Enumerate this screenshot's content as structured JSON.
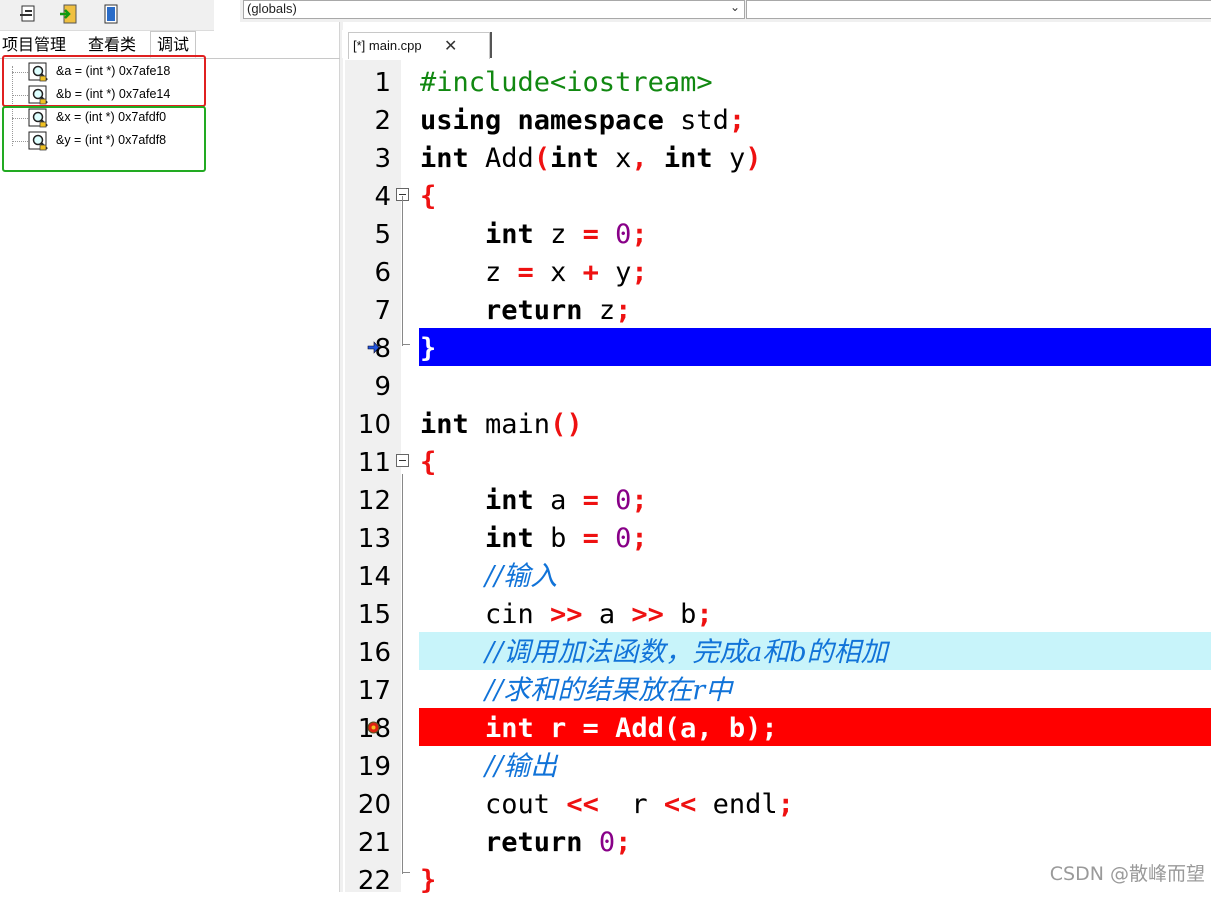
{
  "top_bar": {
    "scope": "(globals)"
  },
  "panel_tabs": [
    "项目管理",
    "查看类",
    "调试"
  ],
  "watches": [
    {
      "text": "&a = (int *) 0x7afe18"
    },
    {
      "text": "&b = (int *) 0x7afe14"
    },
    {
      "text": "&x = (int *) 0x7afdf0"
    },
    {
      "text": "&y = (int *) 0x7afdf8"
    }
  ],
  "editor": {
    "tab_label": "[*] main.cpp",
    "tab_close": "✕",
    "current_line": 8,
    "breakpoint_line": 18,
    "selected_line": 16,
    "colors": {
      "current": "#0000ff",
      "breakpoint": "#ff0000",
      "selected": "#c8f4fa"
    },
    "lines": [
      {
        "n": "1",
        "tokens": [
          {
            "t": "#include<iostream>",
            "c": "pp"
          }
        ]
      },
      {
        "n": "2",
        "tokens": [
          {
            "t": "using namespace",
            "c": "kw"
          },
          {
            "t": " std",
            "c": "id"
          },
          {
            "t": ";",
            "c": "sym"
          }
        ]
      },
      {
        "n": "3",
        "tokens": [
          {
            "t": "int",
            "c": "kw"
          },
          {
            "t": " Add",
            "c": "id"
          },
          {
            "t": "(",
            "c": "sym"
          },
          {
            "t": "int",
            "c": "kw"
          },
          {
            "t": " x",
            "c": "id"
          },
          {
            "t": ",",
            "c": "sym"
          },
          {
            "t": " ",
            "c": "id"
          },
          {
            "t": "int",
            "c": "kw"
          },
          {
            "t": " y",
            "c": "id"
          },
          {
            "t": ")",
            "c": "sym"
          }
        ]
      },
      {
        "n": "4",
        "fold": true,
        "tokens": [
          {
            "t": "{",
            "c": "sym"
          }
        ]
      },
      {
        "n": "5",
        "tokens": [
          {
            "t": "    ",
            "c": "id"
          },
          {
            "t": "int",
            "c": "kw"
          },
          {
            "t": " z ",
            "c": "id"
          },
          {
            "t": "=",
            "c": "sym"
          },
          {
            "t": " ",
            "c": "id"
          },
          {
            "t": "0",
            "c": "num"
          },
          {
            "t": ";",
            "c": "sym"
          }
        ]
      },
      {
        "n": "6",
        "tokens": [
          {
            "t": "    z ",
            "c": "id"
          },
          {
            "t": "=",
            "c": "sym"
          },
          {
            "t": " x ",
            "c": "id"
          },
          {
            "t": "+",
            "c": "sym"
          },
          {
            "t": " y",
            "c": "id"
          },
          {
            "t": ";",
            "c": "sym"
          }
        ]
      },
      {
        "n": "7",
        "tokens": [
          {
            "t": "    ",
            "c": "id"
          },
          {
            "t": "return",
            "c": "kw"
          },
          {
            "t": " z",
            "c": "id"
          },
          {
            "t": ";",
            "c": "sym"
          }
        ]
      },
      {
        "n": "8",
        "tokens": [
          {
            "t": "}",
            "c": "sym"
          }
        ]
      },
      {
        "n": "9",
        "tokens": []
      },
      {
        "n": "10",
        "tokens": [
          {
            "t": "int",
            "c": "kw"
          },
          {
            "t": " main",
            "c": "id"
          },
          {
            "t": "()",
            "c": "sym"
          }
        ]
      },
      {
        "n": "11",
        "fold": true,
        "tokens": [
          {
            "t": "{",
            "c": "sym"
          }
        ]
      },
      {
        "n": "12",
        "tokens": [
          {
            "t": "    ",
            "c": "id"
          },
          {
            "t": "int",
            "c": "kw"
          },
          {
            "t": " a ",
            "c": "id"
          },
          {
            "t": "=",
            "c": "sym"
          },
          {
            "t": " ",
            "c": "id"
          },
          {
            "t": "0",
            "c": "num"
          },
          {
            "t": ";",
            "c": "sym"
          }
        ]
      },
      {
        "n": "13",
        "tokens": [
          {
            "t": "    ",
            "c": "id"
          },
          {
            "t": "int",
            "c": "kw"
          },
          {
            "t": " b ",
            "c": "id"
          },
          {
            "t": "=",
            "c": "sym"
          },
          {
            "t": " ",
            "c": "id"
          },
          {
            "t": "0",
            "c": "num"
          },
          {
            "t": ";",
            "c": "sym"
          }
        ]
      },
      {
        "n": "14",
        "tokens": [
          {
            "t": "    ",
            "c": "id"
          },
          {
            "t": "//输入",
            "c": "cmt"
          }
        ]
      },
      {
        "n": "15",
        "tokens": [
          {
            "t": "    cin ",
            "c": "id"
          },
          {
            "t": ">>",
            "c": "sym"
          },
          {
            "t": " a ",
            "c": "id"
          },
          {
            "t": ">>",
            "c": "sym"
          },
          {
            "t": " b",
            "c": "id"
          },
          {
            "t": ";",
            "c": "sym"
          }
        ]
      },
      {
        "n": "16",
        "tokens": [
          {
            "t": "    ",
            "c": "id"
          },
          {
            "t": "//调用加法函数，完成a和b的相加",
            "c": "cmt"
          }
        ]
      },
      {
        "n": "17",
        "tokens": [
          {
            "t": "    ",
            "c": "id"
          },
          {
            "t": "//求和的结果放在r中",
            "c": "cmt"
          }
        ]
      },
      {
        "n": "18",
        "tokens": [
          {
            "t": "    int r = Add(a, b);",
            "c": "kw"
          }
        ]
      },
      {
        "n": "19",
        "tokens": [
          {
            "t": "    ",
            "c": "id"
          },
          {
            "t": "//输出",
            "c": "cmt"
          }
        ]
      },
      {
        "n": "20",
        "tokens": [
          {
            "t": "    cout ",
            "c": "id"
          },
          {
            "t": "<<",
            "c": "sym"
          },
          {
            "t": "  r ",
            "c": "id"
          },
          {
            "t": "<<",
            "c": "sym"
          },
          {
            "t": " endl",
            "c": "id"
          },
          {
            "t": ";",
            "c": "sym"
          }
        ]
      },
      {
        "n": "21",
        "tokens": [
          {
            "t": "    ",
            "c": "id"
          },
          {
            "t": "return",
            "c": "kw"
          },
          {
            "t": " ",
            "c": "id"
          },
          {
            "t": "0",
            "c": "num"
          },
          {
            "t": ";",
            "c": "sym"
          }
        ]
      },
      {
        "n": "22",
        "tokens": [
          {
            "t": "}",
            "c": "sym"
          }
        ]
      }
    ]
  },
  "watermark": "CSDN @散峰而望"
}
